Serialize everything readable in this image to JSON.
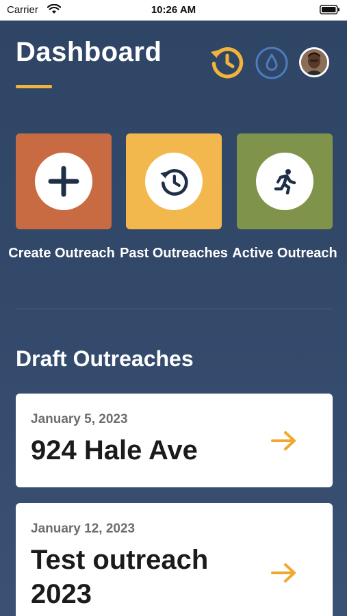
{
  "status_bar": {
    "carrier": "Carrier",
    "time": "10:26 AM",
    "icons": [
      "wifi-icon",
      "battery-icon"
    ]
  },
  "header": {
    "title": "Dashboard",
    "icons": [
      "history-icon",
      "water-drop-icon",
      "profile-avatar"
    ]
  },
  "actions": [
    {
      "label": "Create Outreach",
      "icon": "plus-icon",
      "color": "#c86b43"
    },
    {
      "label": "Past Outreaches",
      "icon": "history-icon",
      "color": "#f2b84d"
    },
    {
      "label": "Active Outreach",
      "icon": "running-person-icon",
      "color": "#7f944a"
    }
  ],
  "drafts": {
    "title": "Draft Outreaches",
    "items": [
      {
        "date": "January 5, 2023",
        "title": "924 Hale Ave"
      },
      {
        "date": "January 12, 2023",
        "title": "Test outreach 2023"
      }
    ]
  },
  "colors": {
    "accent": "#f2b33a",
    "background": "#2e4566",
    "drop_icon": "#4a7dc2"
  }
}
